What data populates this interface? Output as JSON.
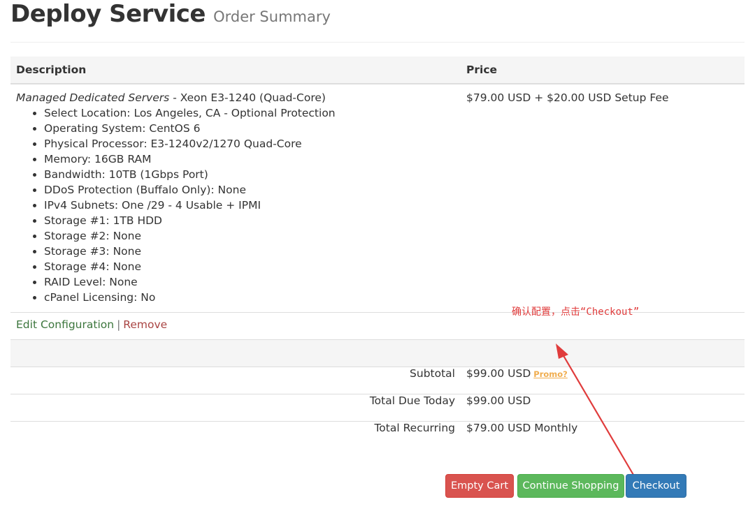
{
  "header": {
    "title": "Deploy Service",
    "subtitle": "Order Summary"
  },
  "table": {
    "columns": [
      "Description",
      "Price"
    ],
    "item": {
      "product": "Managed Dedicated Servers",
      "product_detail": " - Xeon E3-1240 (Quad-Core)",
      "price": "$79.00 USD + $20.00 USD Setup Fee",
      "options": [
        "Select Location: Los Angeles, CA - Optional Protection",
        "Operating System: CentOS 6",
        "Physical Processor: E3-1240v2/1270 Quad-Core",
        "Memory: 16GB RAM",
        "Bandwidth: 10TB (1Gbps Port)",
        "DDoS Protection (Buffalo Only): None",
        "IPv4 Subnets: One /29 - 4 Usable + IPMI",
        "Storage #1: 1TB HDD",
        "Storage #2: None",
        "Storage #3: None",
        "Storage #4: None",
        "RAID Level: None",
        "cPanel Licensing: No"
      ],
      "edit_label": "Edit Configuration",
      "separator": "|",
      "remove_label": "Remove"
    }
  },
  "totals": {
    "subtotal_label": "Subtotal",
    "subtotal_value": "$99.00 USD",
    "promo_label": "Promo?",
    "due_today_label": "Total Due Today",
    "due_today_value": "$99.00 USD",
    "recurring_label": "Total Recurring",
    "recurring_value": "$79.00 USD Monthly"
  },
  "annotation": "确认配置，点击“Checkout”",
  "buttons": {
    "empty_cart": "Empty Cart",
    "continue_shopping": "Continue Shopping",
    "checkout": "Checkout"
  },
  "colors": {
    "danger": "#d9534f",
    "success": "#5cb85c",
    "primary": "#337ab7",
    "annotation": "#e03c3c"
  }
}
